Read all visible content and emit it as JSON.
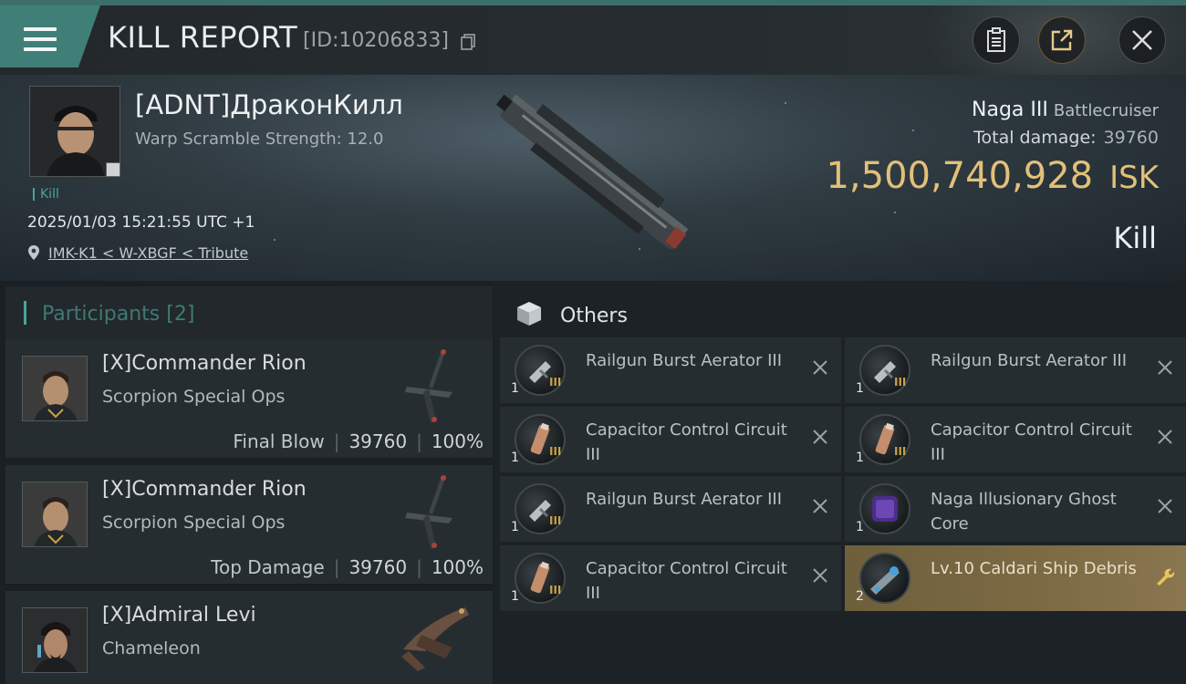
{
  "header": {
    "title": "KILL REPORT",
    "report_id": "[ID:10206833]"
  },
  "victim": {
    "pilot_name": "[ADNT]ДраконКилл",
    "warp_scramble": "Warp Scramble Strength: 12.0",
    "kill_tag": "Kill",
    "date": "2025/01/03 15:21:55 UTC +1",
    "location": "IMK-K1 < W-XBGF < Tribute",
    "ship_name": "Naga III",
    "ship_class": "Battlecruiser",
    "total_damage_label": "Total damage:",
    "total_damage_value": "39760",
    "isk_value": "1,500,740,928",
    "isk_unit": "ISK",
    "result": "Kill"
  },
  "participants": {
    "title": "Participants",
    "count": "[2]",
    "rows": [
      {
        "name": "[X]Commander Rion",
        "ship": "Scorpion Special Ops",
        "role": "Final Blow",
        "damage": "39760",
        "percent": "100%"
      },
      {
        "name": "[X]Commander Rion",
        "ship": "Scorpion Special Ops",
        "role": "Top Damage",
        "damage": "39760",
        "percent": "100%"
      },
      {
        "name": "[X]Admiral Levi",
        "ship": "Chameleon",
        "badge": "i"
      }
    ]
  },
  "others": {
    "title": "Others",
    "items": [
      {
        "name": "Railgun Burst Aerator III",
        "qty": "1",
        "tier": "III",
        "icon": "railgun-aerator-icon"
      },
      {
        "name": "Railgun Burst Aerator III",
        "qty": "1",
        "tier": "III",
        "icon": "railgun-aerator-icon"
      },
      {
        "name": "Capacitor Control Circuit III",
        "qty": "1",
        "tier": "III",
        "icon": "capacitor-circuit-icon"
      },
      {
        "name": "Capacitor Control Circuit III",
        "qty": "1",
        "tier": "III",
        "icon": "capacitor-circuit-icon"
      },
      {
        "name": "Railgun Burst Aerator III",
        "qty": "1",
        "tier": "III",
        "icon": "railgun-aerator-icon"
      },
      {
        "name": "Naga Illusionary Ghost Core",
        "qty": "1",
        "icon": "ghost-core-icon"
      },
      {
        "name": "Capacitor Control Circuit III",
        "qty": "1",
        "tier": "III",
        "icon": "capacitor-circuit-icon"
      },
      {
        "name": "Lv.10 Caldari Ship Debris",
        "qty": "2",
        "icon": "ship-debris-icon"
      }
    ]
  },
  "colors": {
    "accent_teal": "#4da398",
    "isk_gold": "#e2c07a",
    "highlight_item": "#7c6b44"
  }
}
